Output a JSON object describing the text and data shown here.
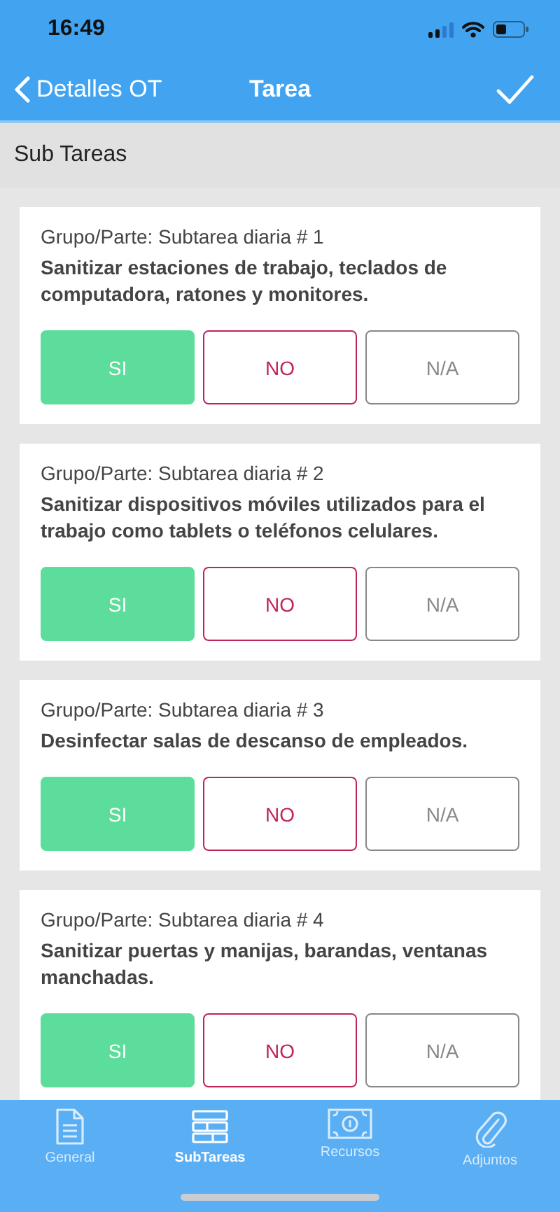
{
  "status_bar": {
    "time": "16:49"
  },
  "nav": {
    "back": "Detalles OT",
    "title": "Tarea"
  },
  "section": {
    "title": "Sub Tareas"
  },
  "tasks": [
    {
      "group": "Grupo/Parte: Subtarea diaria # 1",
      "text": "Sanitizar estaciones de trabajo, teclados de computadora, ratones y monitores.",
      "options": [
        {
          "kind": "yes",
          "label": "SI",
          "selected": true
        },
        {
          "kind": "no",
          "label": "NO",
          "selected": false
        },
        {
          "kind": "na",
          "label": "N/A",
          "selected": false
        }
      ]
    },
    {
      "group": "Grupo/Parte: Subtarea diaria # 2",
      "text": "Sanitizar dispositivos móviles utilizados para el trabajo como tablets o teléfonos celulares.",
      "options": [
        {
          "kind": "yes",
          "label": "SI",
          "selected": true
        },
        {
          "kind": "no",
          "label": "NO",
          "selected": false
        },
        {
          "kind": "na",
          "label": "N/A",
          "selected": false
        }
      ]
    },
    {
      "group": "Grupo/Parte: Subtarea diaria # 3",
      "text": "Desinfectar salas de descanso de empleados.",
      "options": [
        {
          "kind": "yes",
          "label": "SI",
          "selected": true
        },
        {
          "kind": "no",
          "label": "NO",
          "selected": false
        },
        {
          "kind": "na",
          "label": "N/A",
          "selected": false
        }
      ]
    },
    {
      "group": "Grupo/Parte: Subtarea diaria # 4",
      "text": "Sanitizar puertas y manijas, barandas, ventanas manchadas.",
      "options": [
        {
          "kind": "yes",
          "label": "SI",
          "selected": true
        },
        {
          "kind": "no",
          "label": "NO",
          "selected": false
        },
        {
          "kind": "na",
          "label": "N/A",
          "selected": false
        }
      ]
    }
  ],
  "tabs": [
    {
      "kind": "document",
      "label": "General",
      "selected": false
    },
    {
      "kind": "table",
      "label": "SubTareas",
      "selected": true
    },
    {
      "kind": "money",
      "label": "Recursos",
      "selected": false
    },
    {
      "kind": "clip",
      "label": "Adjuntos",
      "selected": false
    }
  ]
}
